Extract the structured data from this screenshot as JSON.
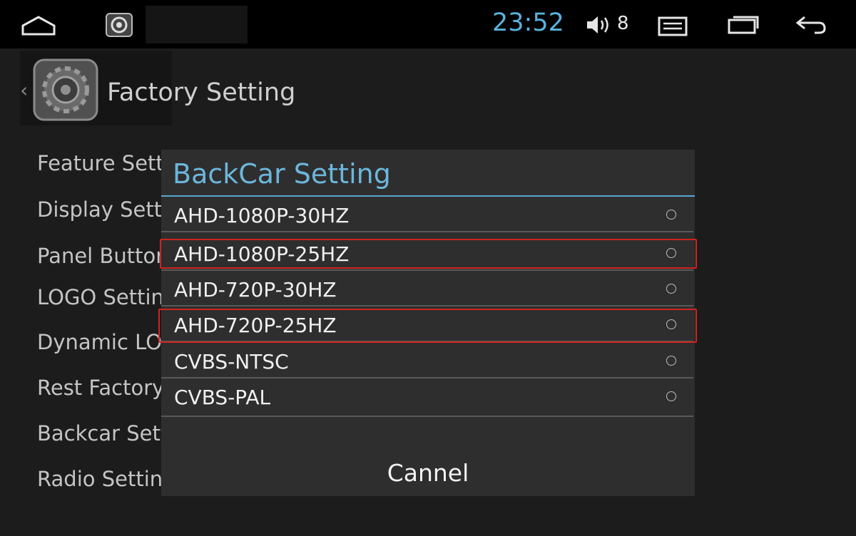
{
  "status_bar": {
    "time": "23:52",
    "volume_level": "8",
    "icons": [
      "home-icon",
      "app-icon",
      "volume-icon",
      "menu-icon",
      "recent-apps-icon",
      "back-icon"
    ]
  },
  "header": {
    "title": "Factory Setting",
    "back_glyph": "‹",
    "icon": "gear-icon"
  },
  "settings_list": {
    "items": [
      "Feature Sett",
      "Display Setti",
      "Panel Buttor",
      "LOGO Setting",
      "Dynamic LOG",
      "Rest Factory",
      "Backcar Sett",
      "Radio Setting"
    ]
  },
  "dialog": {
    "title": "BackCar Setting",
    "options": [
      {
        "label": "AHD-1080P-30HZ",
        "selected": false,
        "highlighted": false
      },
      {
        "label": "AHD-1080P-25HZ",
        "selected": false,
        "highlighted": true
      },
      {
        "label": "AHD-720P-30HZ",
        "selected": false,
        "highlighted": false
      },
      {
        "label": "AHD-720P-25HZ",
        "selected": false,
        "highlighted": true
      },
      {
        "label": "CVBS-NTSC",
        "selected": false,
        "highlighted": false
      },
      {
        "label": "CVBS-PAL",
        "selected": false,
        "highlighted": false
      }
    ],
    "cancel_label": "Cannel",
    "highlight_color": "#d0241f",
    "accent_color": "#6cb6dc"
  }
}
